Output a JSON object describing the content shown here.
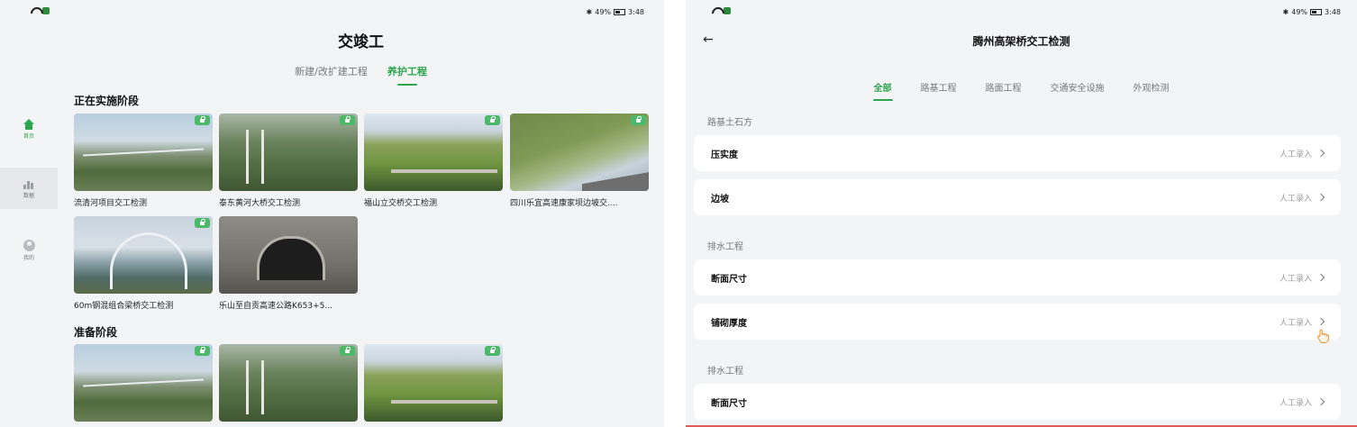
{
  "left": {
    "status": {
      "battery": "49%",
      "time": "3:48"
    },
    "sidebar": [
      {
        "label": "首页",
        "active": true
      },
      {
        "label": "数据",
        "active": false
      },
      {
        "label": "我的",
        "active": false
      }
    ],
    "title": "交竣工",
    "tabs": [
      {
        "label": "新建/改扩建工程",
        "active": false
      },
      {
        "label": "养护工程",
        "active": true
      }
    ],
    "sections": [
      {
        "title": "正在实施阶段",
        "cards": [
          "流清河项目交工检测",
          "泰东黄河大桥交工检测",
          "福山立交桥交工检测",
          "四川乐宜高速康家坝边坡交....",
          "60m钢混组合梁桥交工检测",
          "乐山至自贡高速公路K653+5..."
        ]
      },
      {
        "title": "准备阶段",
        "cards": [
          "",
          "",
          ""
        ]
      }
    ]
  },
  "right": {
    "status": {
      "battery": "49%",
      "time": "3:48"
    },
    "back_icon": "←",
    "title": "腾州高架桥交工检测",
    "tabs": [
      {
        "label": "全部",
        "active": true
      },
      {
        "label": "路基工程",
        "active": false
      },
      {
        "label": "路面工程",
        "active": false
      },
      {
        "label": "交通安全设施",
        "active": false
      },
      {
        "label": "外观检测",
        "active": false
      }
    ],
    "groups": [
      {
        "label": "路基土石方",
        "rows": [
          {
            "title": "压实度",
            "action": "人工录入"
          },
          {
            "title": "边坡",
            "action": "人工录入"
          }
        ]
      },
      {
        "label": "排水工程",
        "rows": [
          {
            "title": "断面尺寸",
            "action": "人工录入"
          },
          {
            "title": "铺砌厚度",
            "action": "人工录入"
          }
        ]
      },
      {
        "label": "排水工程",
        "rows": [
          {
            "title": "断面尺寸",
            "action": "人工录入"
          }
        ]
      }
    ]
  }
}
